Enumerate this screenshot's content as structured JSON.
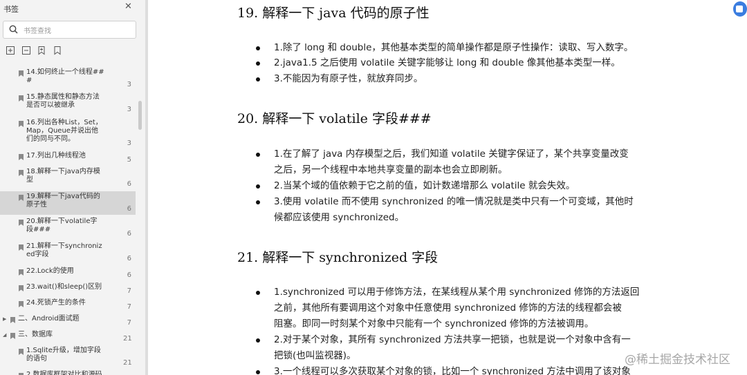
{
  "sidebar": {
    "title": "书签",
    "search_placeholder": "书签查找",
    "items": [
      {
        "lines": [
          "14.如何终止一个线程##",
          "#"
        ],
        "page": "3"
      },
      {
        "lines": [
          "15.静态属性和静态方法",
          "是否可以被继承"
        ],
        "page": "3"
      },
      {
        "lines": [
          "16.列出各种List，Set，",
          "Map，Queue并说出他",
          "们的同与不同。"
        ],
        "page": "3"
      },
      {
        "lines": [
          "17.列出几种线程池"
        ],
        "page": "5"
      },
      {
        "lines": [
          "18.解释一下java内存模",
          "型"
        ],
        "page": "6"
      },
      {
        "lines": [
          "19.解释一下java代码的",
          "原子性"
        ],
        "page": "6",
        "selected": true
      },
      {
        "lines": [
          "20.解释一下volatile字",
          "段###"
        ],
        "page": "6"
      },
      {
        "lines": [
          "21.解释一下synchroniz",
          "ed字段"
        ],
        "page": "6"
      },
      {
        "lines": [
          "22.Lock的使用"
        ],
        "page": "6"
      },
      {
        "lines": [
          "23.wait()和sleep()区别"
        ],
        "page": "7"
      },
      {
        "lines": [
          "24.死锁产生的条件"
        ],
        "page": "7"
      },
      {
        "lines": [
          "二、Android面试题"
        ],
        "page": "7",
        "level": 0,
        "expand": "collapsed"
      },
      {
        "lines": [
          "三、数据库"
        ],
        "page": "21",
        "level": 0,
        "expand": "expanded"
      },
      {
        "lines": [
          "1.Sqlite升级，增加字段",
          "的语句"
        ],
        "page": "21"
      },
      {
        "lines": [
          "2.数据库框架对比和源码"
        ],
        "page": ""
      }
    ]
  },
  "document": {
    "sections": [
      {
        "heading": "19. 解释一下 java 代码的原子性",
        "items": [
          [
            "1.除了 long 和 double，其他基本类型的简单操作都是原子性操作：读取、写入数字。"
          ],
          [
            "2.java1.5 之后使用 volatile 关键字能够让 long 和 double 像其他基本类型一样。"
          ],
          [
            "3.不能因为有原子性，就放弃同步。"
          ]
        ]
      },
      {
        "heading": "20. 解释一下 volatile 字段###",
        "items": [
          [
            "1.在了解了 java 内存模型之后，我们知道 volatile 关键字保证了，某个共享变量改变",
            "之后，另一个线程中本地共享变量的副本也会立即刷新。"
          ],
          [
            "2.当某个域的值依赖于它之前的值，如计数递增那么 volatile 就会失效。"
          ],
          [
            "3.使用 volatile 而不使用 synchronized 的唯一情况就是类中只有一个可变域，其他时",
            "候都应该使用 synchronized。"
          ]
        ]
      },
      {
        "heading": "21. 解释一下 synchronized 字段",
        "items": [
          [
            "1.synchronized 可以用于修饰方法，在某线程从某个用 synchronized 修饰的方法返回",
            "之前，其他所有要调用这个对象中任意使用 synchronized 修饰的方法的线程都会被",
            "阻塞。即同一时刻某个对象中只能有一个 synchronized 修饰的方法被调用。"
          ],
          [
            "2.对于某个对象，其所有 synchronized 方法共享一把锁，也就是说一个对象中含有一",
            "把锁(也叫监视器)。"
          ],
          [
            "3.一个线程可以多次获取某个对象的锁，比如一个 synchronized 方法中调用了该对象"
          ]
        ]
      }
    ]
  },
  "watermark": "@稀土掘金技术社区",
  "colors": {
    "sidebar_bg": "#f3f3f3",
    "selected_bg": "#d6d6d6",
    "float_button": "#3b7de0"
  },
  "icons": [
    "close-icon",
    "search-icon",
    "expand-all-icon",
    "collapse-all-icon",
    "add-bookmark-icon",
    "bookmark-icon",
    "bookmark-flag-icon",
    "float-tool-icon"
  ]
}
